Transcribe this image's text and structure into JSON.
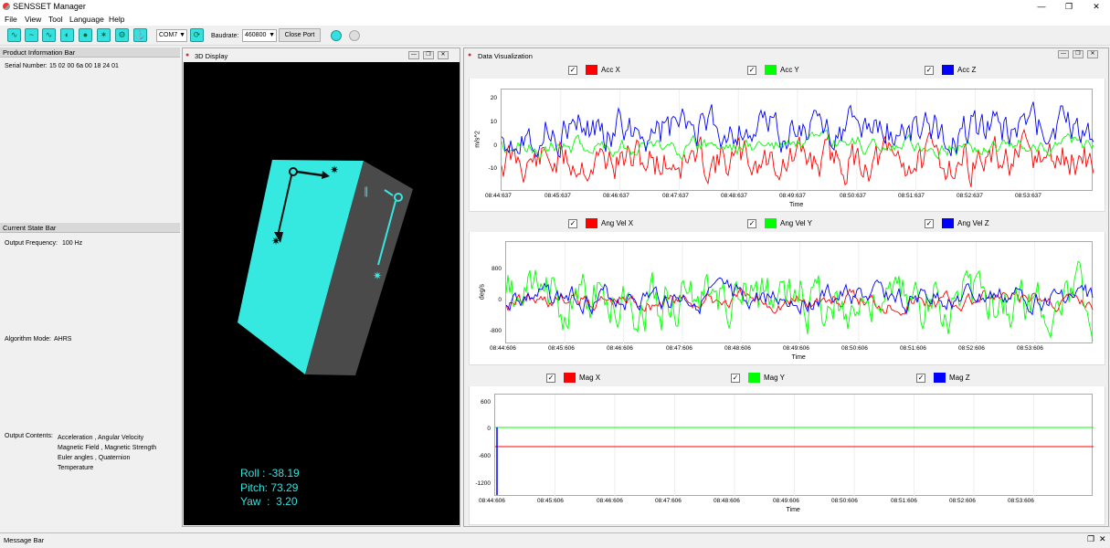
{
  "app": {
    "title": "SENSSET Manager"
  },
  "menu": [
    "File",
    "View",
    "Tool",
    "Language",
    "Help"
  ],
  "toolbar": {
    "icons": [
      "chart-icon",
      "wave-icon",
      "pulse-icon",
      "gauge-icon",
      "location-icon",
      "compass-icon",
      "gear-icon",
      "anchor-icon"
    ],
    "port": "COM7",
    "baudrate_label": "Baudrate:",
    "baudrate": "460800",
    "close_port": "Close Port"
  },
  "left": {
    "product_info_title": "Product Information Bar",
    "serial_label": "Serial Number:",
    "serial_value": "15 02 00 6a 00 18 24 01",
    "current_state_title": "Current State Bar",
    "output_freq_label": "Output Frequency:",
    "output_freq_value": "100 Hz",
    "algorithm_label": "Algorithm Mode:",
    "algorithm_value": "AHRS",
    "output_contents_label": "Output Contents:",
    "output_contents": [
      "Acceleration , Angular Velocity",
      "Magnetic Field , Magnetic Strength",
      "Euler angles , Quaternion",
      "Temperature"
    ]
  },
  "display3d": {
    "title": "3D Display",
    "roll_label": "Roll :",
    "roll": "-38.19",
    "pitch_label": "Pitch:",
    "pitch": "73.29",
    "yaw_label": "Yaw  :",
    "yaw": "3.20"
  },
  "dataviz": {
    "title": "Data Visualization",
    "charts": [
      {
        "legend": [
          "Acc X",
          "Acc Y",
          "Acc Z"
        ],
        "ylabel": "m/s^2",
        "xlabel": "Time",
        "yticks": [
          "20",
          "10",
          "0",
          "-10"
        ],
        "xticks": [
          "08:44:637",
          "08:45:637",
          "08:46:637",
          "08:47:637",
          "08:48:637",
          "08:49:637",
          "08:50:637",
          "08:51:637",
          "08:52:637",
          "08:53:637"
        ]
      },
      {
        "legend": [
          "Ang Vel X",
          "Ang Vel Y",
          "Ang Vel Z"
        ],
        "ylabel": "deg/s",
        "xlabel": "Time",
        "yticks": [
          "800",
          "0",
          "-800"
        ],
        "xticks": [
          "08:44:606",
          "08:45:606",
          "08:46:606",
          "08:47:606",
          "08:48:606",
          "08:49:606",
          "08:50:606",
          "08:51:606",
          "08:52:606",
          "08:53:606"
        ]
      },
      {
        "legend": [
          "Mag X",
          "Mag Y",
          "Mag Z"
        ],
        "ylabel": "",
        "xlabel": "Time",
        "yticks": [
          "600",
          "0",
          "-600",
          "-1200"
        ],
        "xticks": [
          "08:44:606",
          "08:45:606",
          "08:46:606",
          "08:47:606",
          "08:48:606",
          "08:49:606",
          "08:50:606",
          "08:51:606",
          "08:52:606",
          "08:53:606"
        ]
      }
    ],
    "colors": {
      "x": "#ff0000",
      "y": "#00ff00",
      "z": "#0000ff"
    }
  },
  "message_bar": {
    "title": "Message Bar"
  }
}
